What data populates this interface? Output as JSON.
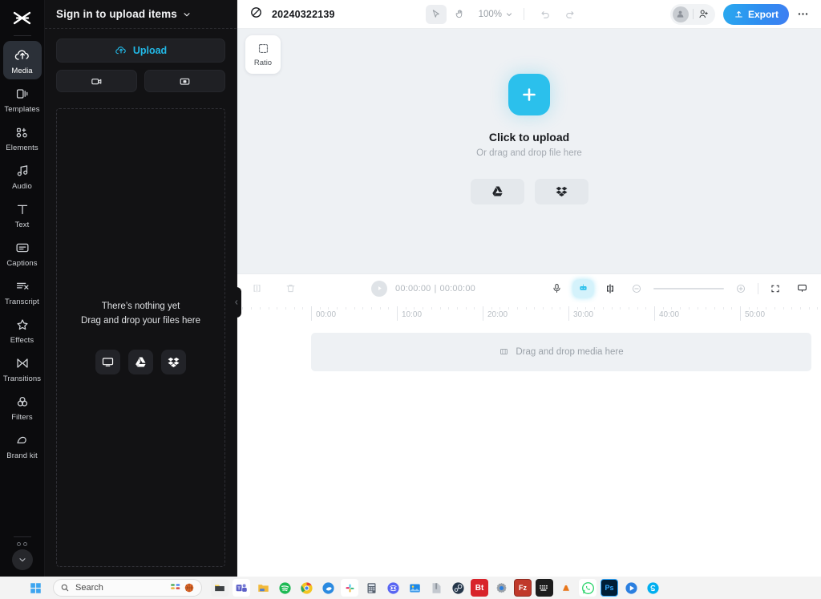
{
  "rail": {
    "logo_icon": "capcut-logo-icon",
    "items": [
      {
        "label": "Media",
        "icon": "cloud-upload-icon",
        "active": true
      },
      {
        "label": "Templates",
        "icon": "templates-icon",
        "active": false
      },
      {
        "label": "Elements",
        "icon": "elements-icon",
        "active": false
      },
      {
        "label": "Audio",
        "icon": "music-note-icon",
        "active": false
      },
      {
        "label": "Text",
        "icon": "text-t-icon",
        "active": false
      },
      {
        "label": "Captions",
        "icon": "captions-icon",
        "active": false
      },
      {
        "label": "Transcript",
        "icon": "transcript-icon",
        "active": false
      },
      {
        "label": "Effects",
        "icon": "sparkle-star-icon",
        "active": false
      },
      {
        "label": "Transitions",
        "icon": "transitions-icon",
        "active": false
      },
      {
        "label": "Filters",
        "icon": "filters-circles-icon",
        "active": false
      },
      {
        "label": "Brand kit",
        "icon": "brand-kit-icon",
        "active": false
      }
    ],
    "expand_icon": "chevron-down-icon"
  },
  "panel": {
    "title": "Sign in to upload items",
    "title_chevron": "chevron-down-icon",
    "upload_label": "Upload",
    "upload_icon": "cloud-upload-icon",
    "record_video_icon": "camera-icon",
    "record_screen_icon": "screen-record-icon",
    "empty_line1": "There’s nothing yet",
    "empty_line2": "Drag and drop your files here",
    "sources": [
      {
        "name": "device-icon"
      },
      {
        "name": "google-drive-icon"
      },
      {
        "name": "dropbox-icon"
      }
    ],
    "collapse_icon": "chevron-left-icon"
  },
  "topbar": {
    "logo_icon": "capcut-mark-icon",
    "project_name": "20240322139",
    "select_tool_icon": "cursor-arrow-icon",
    "hand_tool_icon": "hand-icon",
    "zoom_level": "100%",
    "zoom_chevron": "chevron-down-icon",
    "undo_icon": "undo-icon",
    "redo_icon": "redo-icon",
    "avatar_icon": "avatar-icon",
    "add_member_icon": "add-person-icon",
    "export_label": "Export",
    "export_icon": "export-upload-icon",
    "export_color": "#2e8ef0",
    "more_icon": "more-horizontal-icon"
  },
  "canvas": {
    "ratio_label": "Ratio",
    "ratio_icon": "crop-dashed-icon",
    "plus_icon": "plus-icon",
    "plus_color": "#2bc0ec",
    "upload_title": "Click to upload",
    "upload_subtitle": "Or drag and drop file here",
    "sources": [
      {
        "name": "google-drive-icon"
      },
      {
        "name": "dropbox-icon"
      }
    ]
  },
  "timeline": {
    "split_icon": "split-clip-icon",
    "delete_icon": "trash-icon",
    "play_icon": "play-icon",
    "current_time": "00:00:00",
    "time_separator": "|",
    "total_time": "00:00:00",
    "mic_icon": "microphone-icon",
    "ai_icon": "ai-magic-icon",
    "ai_color": "#2bc0ec",
    "marker_icon": "clip-marker-icon",
    "zoom_out_icon": "minus-circle-icon",
    "zoom_in_icon": "plus-circle-icon",
    "fit_icon": "fit-screen-icon",
    "preview_icon": "monitor-icon",
    "ruler_labels": [
      "00:00",
      "10:00",
      "20:00",
      "30:00",
      "40:00",
      "50:00"
    ],
    "track_placeholder": "Drag and drop media here",
    "track_icon": "film-strip-icon"
  },
  "taskbar": {
    "start_icon": "windows-start-icon",
    "search_icon": "search-icon",
    "search_placeholder": "Search",
    "widget_icons": [
      "weather-widget-icon",
      "basketball-icon"
    ],
    "apps": [
      {
        "name": "file-explorer-icon",
        "color": "#f7c948",
        "glyph": ""
      },
      {
        "name": "microsoft-teams-icon",
        "color": "#5b5fc7",
        "glyph": "T"
      },
      {
        "name": "folder-icon",
        "color": "#f5b93a",
        "glyph": ""
      },
      {
        "name": "spotify-icon",
        "color": "#1db954",
        "glyph": ""
      },
      {
        "name": "chrome-icon",
        "color": "#e94235",
        "glyph": ""
      },
      {
        "name": "edge-dev-icon",
        "color": "#2b8ae0",
        "glyph": ""
      },
      {
        "name": "slack-icon",
        "color": "#ffffff",
        "glyph": ""
      },
      {
        "name": "calculator-icon",
        "color": "#4f5561",
        "glyph": ""
      },
      {
        "name": "discord-icon",
        "color": "#5865f2",
        "glyph": ""
      },
      {
        "name": "photos-icon",
        "color": "#1e88e5",
        "glyph": ""
      },
      {
        "name": "zip-archive-icon",
        "color": "#b9bec6",
        "glyph": ""
      },
      {
        "name": "steam-icon",
        "color": "#2a3f5a",
        "glyph": ""
      },
      {
        "name": "bittorrent-icon",
        "color": "#d8232a",
        "glyph": "Bt"
      },
      {
        "name": "settings-gear-icon",
        "color": "#8a9099",
        "glyph": ""
      },
      {
        "name": "filezilla-icon",
        "color": "#c0392b",
        "glyph": "Fz"
      },
      {
        "name": "keyboard-icon",
        "color": "#1c1c1c",
        "glyph": ""
      },
      {
        "name": "vlc-icon",
        "color": "#e8761b",
        "glyph": ""
      },
      {
        "name": "whatsapp-icon",
        "color": "#25d366",
        "glyph": ""
      },
      {
        "name": "photoshop-icon",
        "color": "#001e36",
        "glyph": "Ps"
      },
      {
        "name": "media-player-icon",
        "color": "#2b7fe0",
        "glyph": ""
      },
      {
        "name": "skype-icon",
        "color": "#00aff0",
        "glyph": ""
      }
    ]
  }
}
